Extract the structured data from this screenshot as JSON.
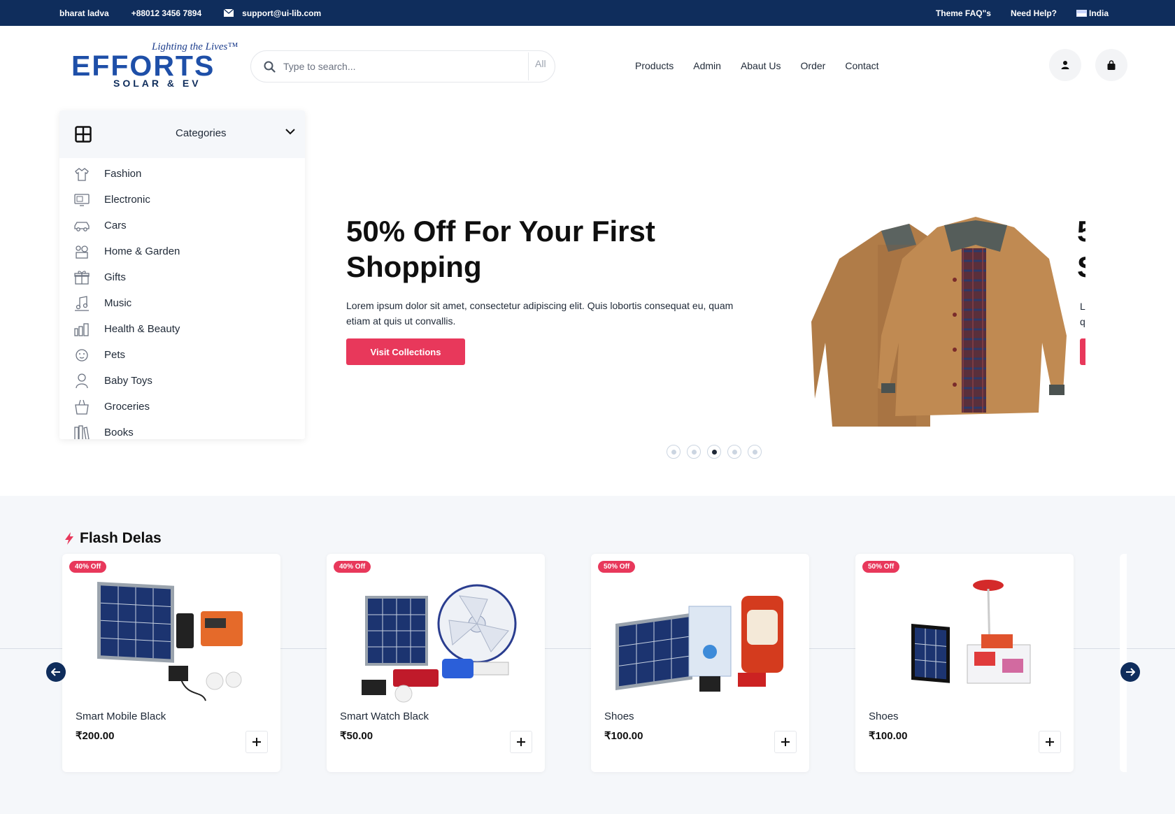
{
  "topbar": {
    "name": "bharat ladva",
    "phone": "+88012 3456 7894",
    "email": "support@ui-lib.com",
    "faq": "Theme FAQ\"s",
    "help": "Need Help?",
    "language": "India"
  },
  "header": {
    "logo": {
      "tagline": "Lighting the Lives™",
      "brand": "EFFORTS",
      "subtitle": "SOLAR & EV"
    },
    "search": {
      "placeholder": "Type to search...",
      "category": "All"
    },
    "nav": [
      "Products",
      "Admin",
      "Abaut Us",
      "Order",
      "Contact"
    ]
  },
  "categories": {
    "title": "Categories",
    "items": [
      {
        "label": "Fashion",
        "icon": "fashion-icon"
      },
      {
        "label": "Electronic",
        "icon": "electronic-icon"
      },
      {
        "label": "Cars",
        "icon": "car-icon"
      },
      {
        "label": "Home & Garden",
        "icon": "home-garden-icon"
      },
      {
        "label": "Gifts",
        "icon": "gift-icon"
      },
      {
        "label": "Music",
        "icon": "music-icon"
      },
      {
        "label": "Health & Beauty",
        "icon": "health-beauty-icon"
      },
      {
        "label": "Pets",
        "icon": "pets-icon"
      },
      {
        "label": "Baby Toys",
        "icon": "baby-toys-icon"
      },
      {
        "label": "Groceries",
        "icon": "groceries-icon"
      },
      {
        "label": "Books",
        "icon": "books-icon"
      }
    ]
  },
  "hero": {
    "title": "50% Off For Your First Shopping",
    "text": "Lorem ipsum dolor sit amet, consectetur adipiscing elit. Quis lobortis consequat eu, quam etiam at quis ut convallis.",
    "button": "Visit Collections",
    "peek_title": "5 S",
    "peek_text": "L q",
    "slide_count": 5,
    "active_slide": 3
  },
  "flash": {
    "title": "Flash Delas",
    "products": [
      {
        "name": "Smart Mobile Black",
        "price": "₹200.00",
        "badge": "40% Off"
      },
      {
        "name": "Smart Watch Black",
        "price": "₹50.00",
        "badge": "40% Off"
      },
      {
        "name": "Shoes",
        "price": "₹100.00",
        "badge": "50% Off"
      },
      {
        "name": "Shoes",
        "price": "₹100.00",
        "badge": "50% Off"
      }
    ]
  },
  "colors": {
    "navy": "#0f2d5c",
    "accent": "#e8385b",
    "section_bg": "#f5f7fa"
  }
}
